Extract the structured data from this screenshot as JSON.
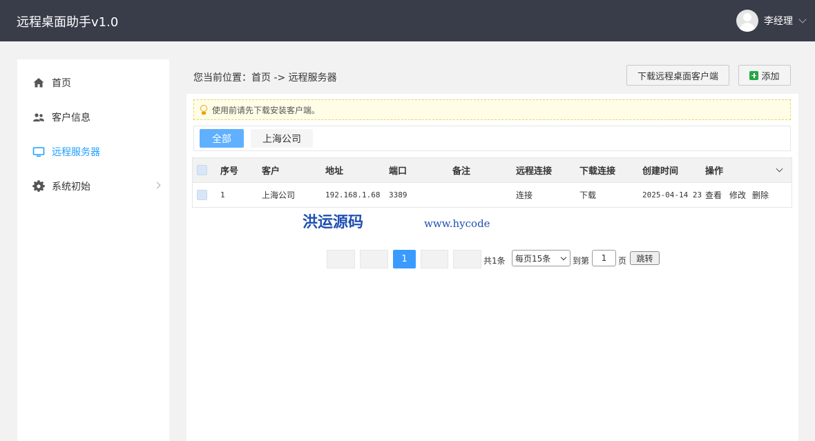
{
  "header": {
    "title": "远程桌面助手v1.0",
    "user_name": "李经理"
  },
  "sidebar": {
    "items": [
      {
        "label": "首页",
        "icon": "home-icon"
      },
      {
        "label": "客户信息",
        "icon": "users-icon"
      },
      {
        "label": "远程服务器",
        "icon": "monitor-icon",
        "active": true
      },
      {
        "label": "系统初始",
        "icon": "gear-icon"
      }
    ]
  },
  "main": {
    "breadcrumb": "您当前位置：首页 -> 远程服务器",
    "download_button": "下载远程桌面客户端",
    "add_button": "添加",
    "notice": "使用前请先下载安装客户端。",
    "tabs": [
      "全部",
      "上海公司"
    ],
    "table": {
      "columns": [
        "序号",
        "客户",
        "地址",
        "端口",
        "备注",
        "远程连接",
        "下载连接",
        "创建时间",
        "操作"
      ],
      "rows": [
        {
          "index": "1",
          "customer": "上海公司",
          "address": "192.168.1.68",
          "port": "3389",
          "remark": "",
          "connect": "连接",
          "download": "下载",
          "created": "2025-04-14 23",
          "actions": [
            "查看",
            "修改",
            "删除"
          ]
        }
      ]
    },
    "pager": {
      "current_page": "1",
      "total_prefix": "共",
      "total_count": "1",
      "total_suffix": "条",
      "page_size": "每页15条",
      "goto_prefix": "到第",
      "goto_value": "1",
      "goto_suffix": "页",
      "jump_button": "跳转"
    }
  },
  "watermark": {
    "text": "洪运源码",
    "url": "www.hycode"
  },
  "colors": {
    "header_bg": "#393d49",
    "accent": "#1E9FFF",
    "link": "#1e6fb8"
  }
}
